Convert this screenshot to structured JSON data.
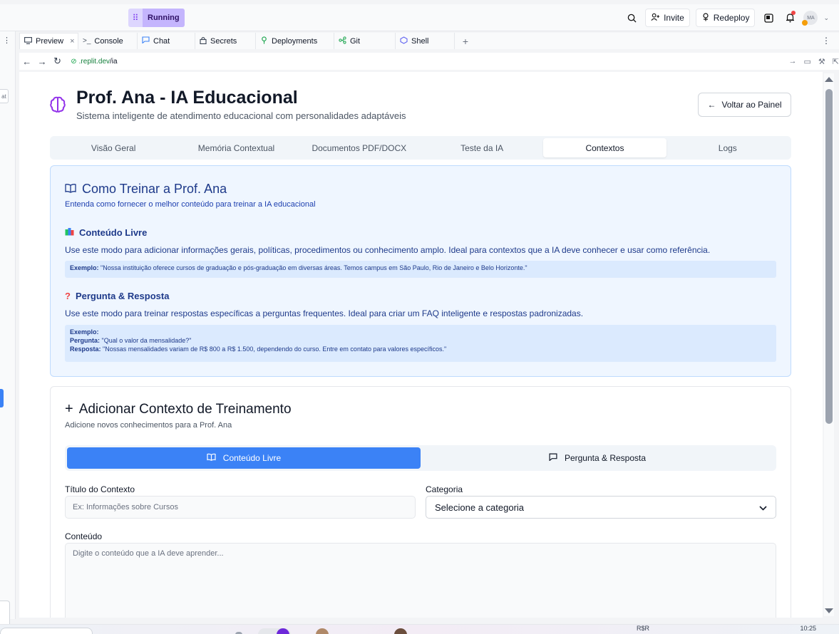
{
  "topbar": {
    "status": "Running",
    "invite_label": "Invite",
    "redeploy_label": "Redeploy",
    "avatar_initials": "MA"
  },
  "left": {
    "box_text": "at"
  },
  "tabs": [
    {
      "label": "Preview",
      "icon": "monitor-icon"
    },
    {
      "label": "Console",
      "icon": "terminal-icon"
    },
    {
      "label": "Chat",
      "icon": "chat-icon"
    },
    {
      "label": "Secrets",
      "icon": "lock-icon"
    },
    {
      "label": "Deployments",
      "icon": "deploy-icon"
    },
    {
      "label": "Git",
      "icon": "git-icon"
    },
    {
      "label": "Shell",
      "icon": "shell-icon"
    }
  ],
  "url": {
    "domain": ".replit.dev",
    "path": "/ia"
  },
  "app": {
    "title": "Prof. Ana - IA Educacional",
    "subtitle": "Sistema inteligente de atendimento educacional com personalidades adaptáveis",
    "back_label": "Voltar ao Painel",
    "tabs": [
      "Visão Geral",
      "Memória Contextual",
      "Documentos PDF/DOCX",
      "Teste da IA",
      "Contextos",
      "Logs"
    ],
    "active_tab": 4
  },
  "guide": {
    "title": "Como Treinar a Prof. Ana",
    "subtitle": "Entenda como fornecer o melhor conteúdo para treinar a IA educacional",
    "free": {
      "heading": "Conteúdo Livre",
      "text": "Use este modo para adicionar informações gerais, políticas, procedimentos ou conhecimento amplo. Ideal para contextos que a IA deve conhecer e usar como referência.",
      "example_label": "Exemplo:",
      "example_text": "\"Nossa instituição oferece cursos de graduação e pós-graduação em diversas áreas. Temos campus em São Paulo, Rio de Janeiro e Belo Horizonte.\""
    },
    "qa": {
      "heading": "Pergunta & Resposta",
      "text": "Use este modo para treinar respostas específicas a perguntas frequentes. Ideal para criar um FAQ inteligente e respostas padronizadas.",
      "example_label": "Exemplo:",
      "question_label": "Pergunta:",
      "question_text": "\"Qual o valor da mensalidade?\"",
      "answer_label": "Resposta:",
      "answer_text": "\"Nossas mensalidades variam de R$ 800 a R$ 1.500, dependendo do curso. Entre em contato para valores específicos.\""
    }
  },
  "form": {
    "title": "Adicionar Contexto de Treinamento",
    "subtitle": "Adicione novos conhecimentos para a Prof. Ana",
    "mode_free": "Conteúdo Livre",
    "mode_qa": "Pergunta & Resposta",
    "title_label": "Título do Contexto",
    "title_value": "",
    "title_placeholder": "Ex: Informações sobre Cursos",
    "category_label": "Categoria",
    "category_value": "Selecione a categoria",
    "content_label": "Conteúdo",
    "content_value": "",
    "content_placeholder": "Digite o conteúdo que a IA deve aprender..."
  },
  "taskbar": {
    "value_text": "R$R",
    "time": "10:25"
  },
  "colors": {
    "accent": "#3b82f6",
    "running": "#c4b5fd",
    "guide_bg": "#eff6ff",
    "brain": "#9333ea"
  }
}
